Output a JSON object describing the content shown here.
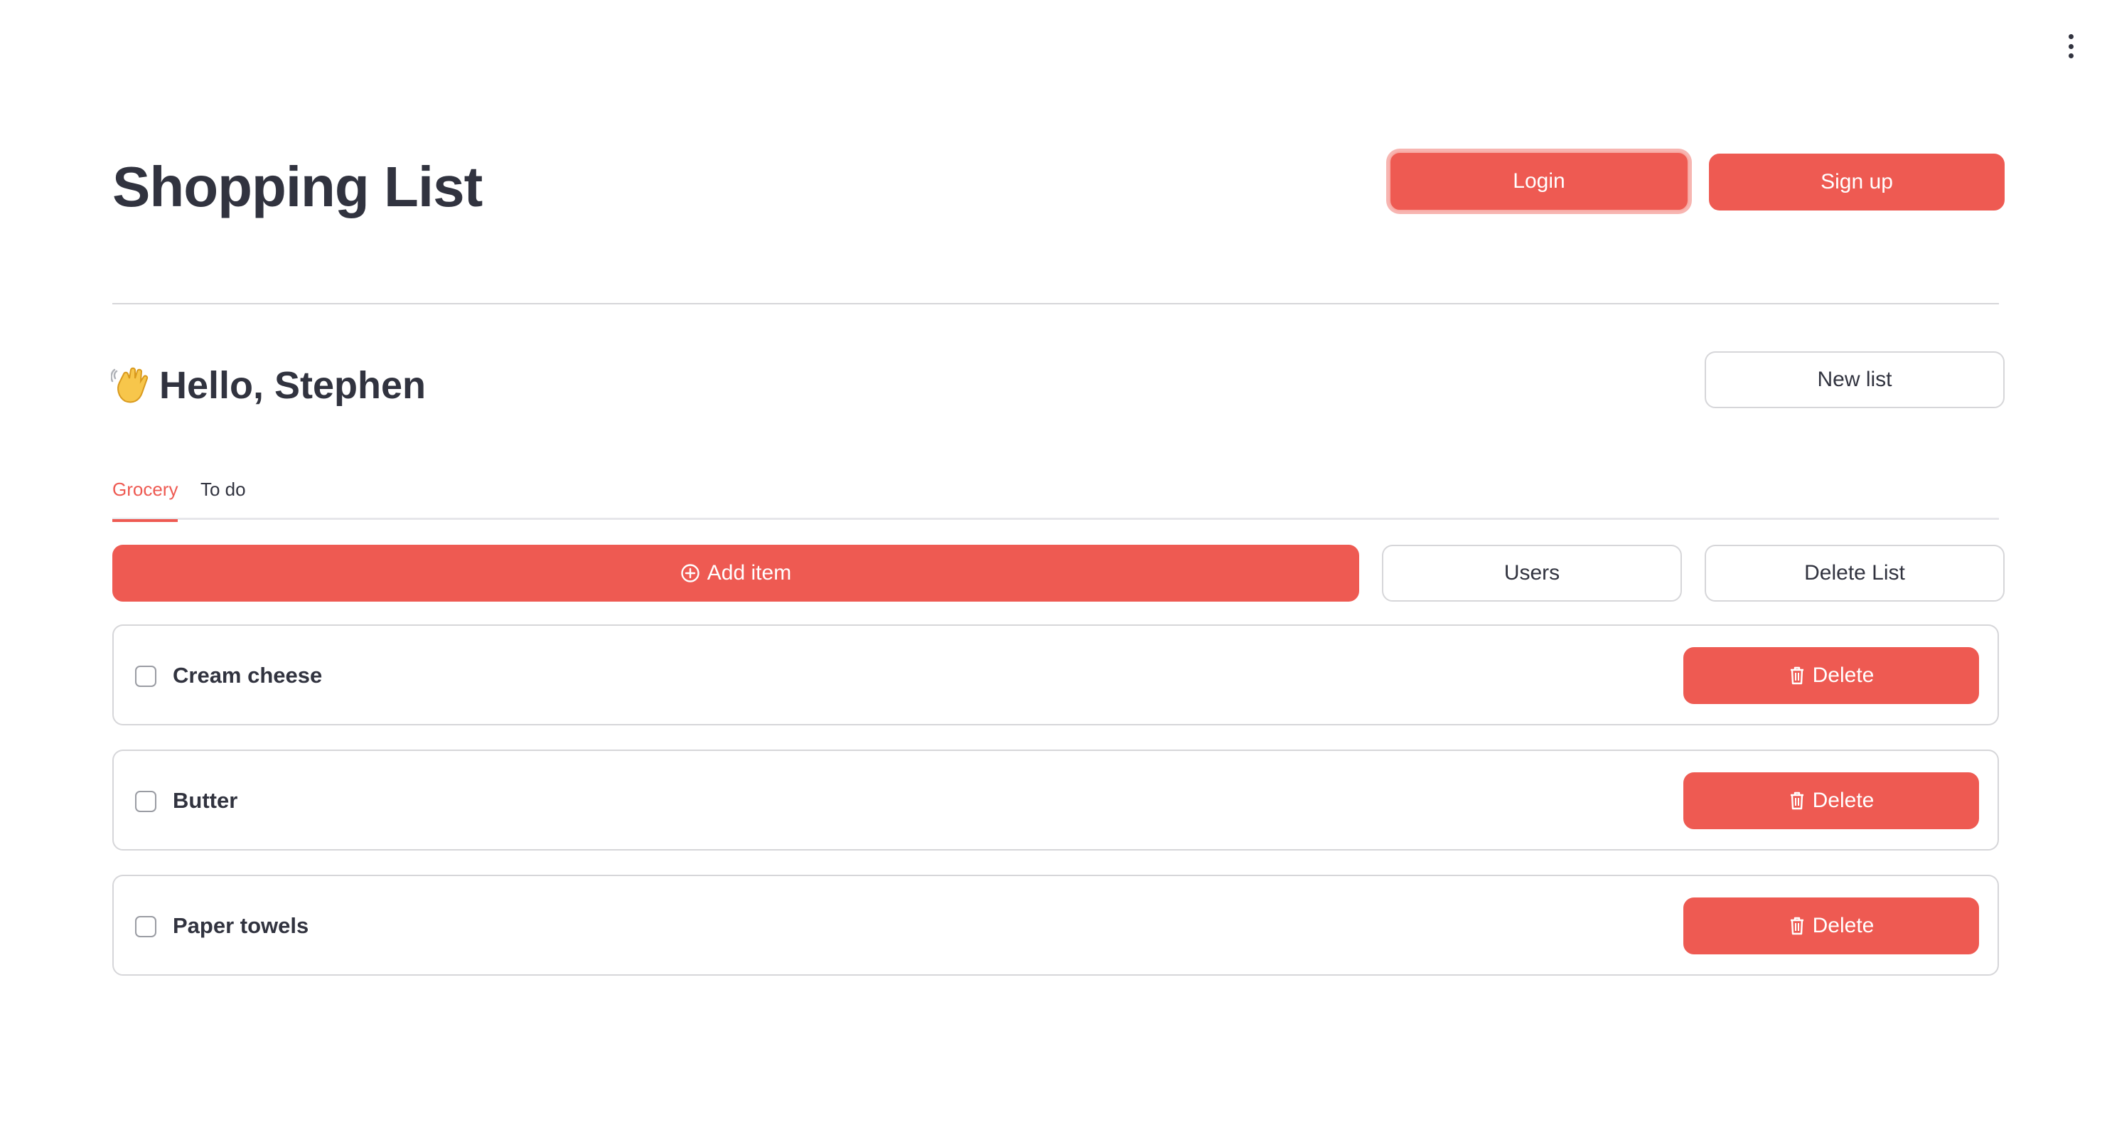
{
  "app": {
    "title": "Shopping List"
  },
  "header": {
    "login_label": "Login",
    "signup_label": "Sign up"
  },
  "greeting": {
    "emoji_icon": "waving-hand-icon",
    "text": "Hello, Stephen",
    "new_list_label": "New list"
  },
  "tabs": [
    {
      "label": "Grocery",
      "active": true
    },
    {
      "label": "To do",
      "active": false
    }
  ],
  "toolbar": {
    "add_item_icon": "plus-circle-icon",
    "add_item_label": "Add item",
    "users_label": "Users",
    "delete_list_label": "Delete List"
  },
  "items": [
    {
      "label": "Cream cheese",
      "checked": false,
      "delete_label": "Delete"
    },
    {
      "label": "Butter",
      "checked": false,
      "delete_label": "Delete"
    },
    {
      "label": "Paper towels",
      "checked": false,
      "delete_label": "Delete"
    }
  ],
  "colors": {
    "primary": "#ee5a52",
    "text": "#31333f",
    "border": "#d6d6d9"
  }
}
